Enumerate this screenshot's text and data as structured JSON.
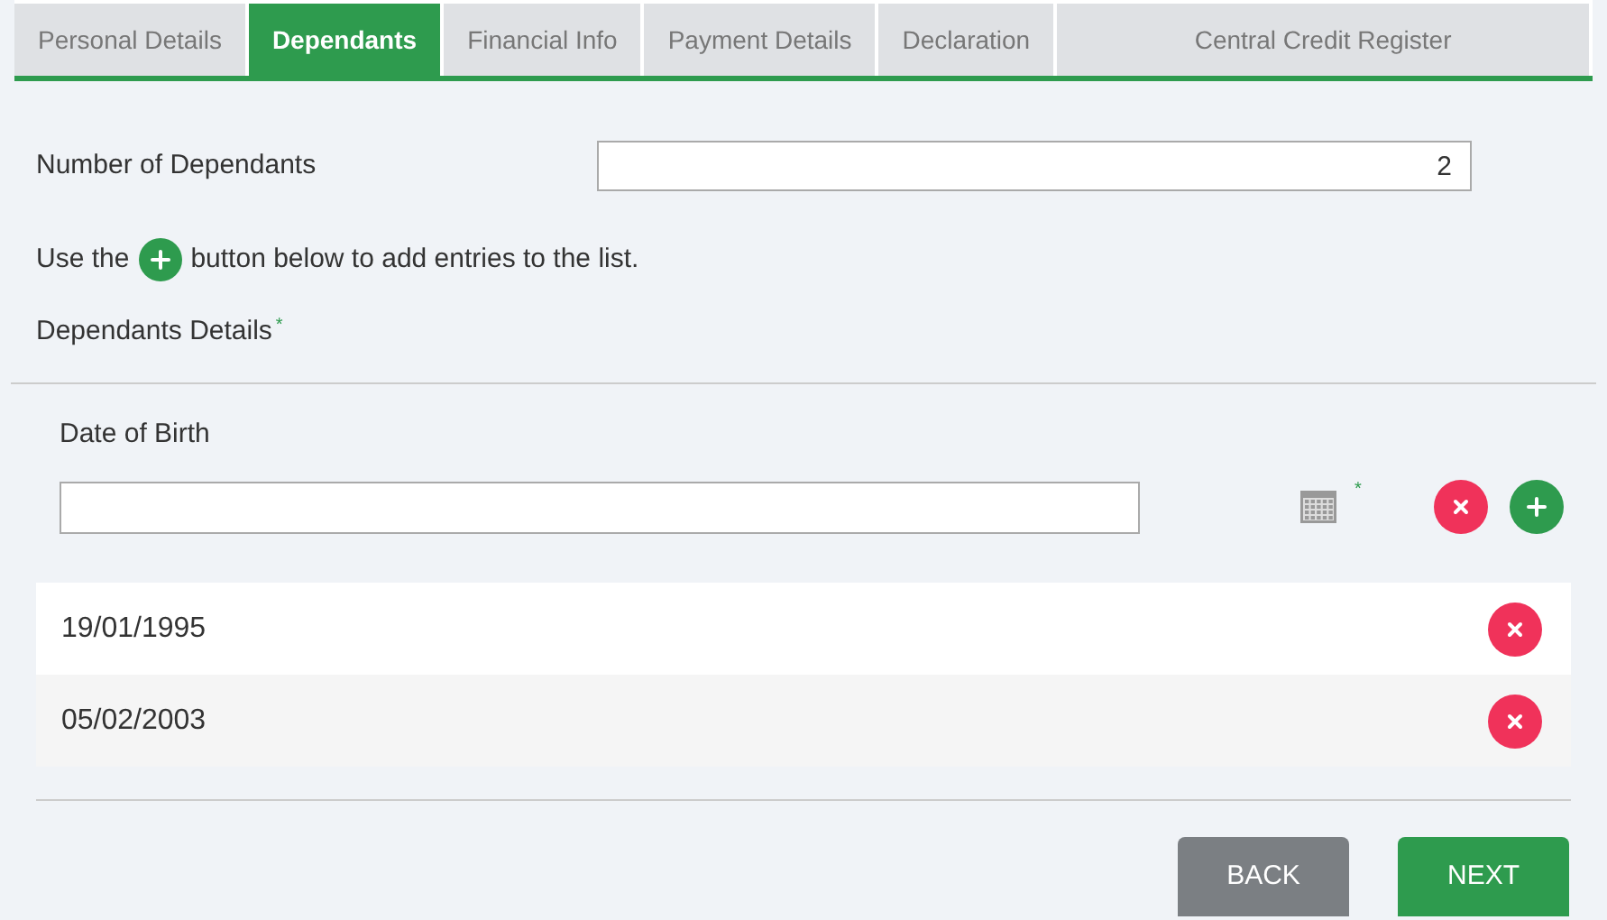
{
  "tabs": [
    {
      "label": "Personal Details",
      "selected": false
    },
    {
      "label": "Dependants",
      "selected": true
    },
    {
      "label": "Financial Info",
      "selected": false
    },
    {
      "label": "Payment Details",
      "selected": false
    },
    {
      "label": "Declaration",
      "selected": false
    },
    {
      "label": "Central Credit Register",
      "selected": false
    }
  ],
  "number_of_dependants": {
    "label": "Number of Dependants",
    "value": "2"
  },
  "hint": {
    "before": "Use the",
    "after": "button below to add entries to the list."
  },
  "details": {
    "label": "Dependants Details",
    "required_mark": "*"
  },
  "date_of_birth": {
    "label": "Date of Birth",
    "required_mark": "*"
  },
  "entries": [
    {
      "date": "19/01/1995"
    },
    {
      "date": "05/02/2003"
    }
  ],
  "buttons": [
    {
      "label": "BACK",
      "kind": "secondary"
    },
    {
      "label": "NEXT",
      "kind": "primary"
    }
  ]
}
